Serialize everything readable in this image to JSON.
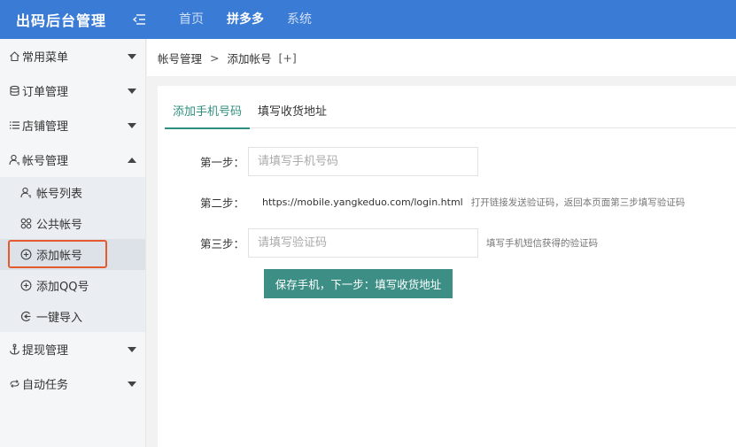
{
  "header": {
    "brand": "出码后台管理",
    "nav": [
      "首页",
      "拼多多",
      "系统"
    ],
    "active_nav": "拼多多"
  },
  "sidebar": {
    "groups": [
      {
        "label": "常用菜单",
        "icon": "home-icon"
      },
      {
        "label": "订单管理",
        "icon": "database-icon"
      },
      {
        "label": "店铺管理",
        "icon": "list-icon"
      },
      {
        "label": "帐号管理",
        "icon": "user-icon",
        "expanded": true
      },
      {
        "label": "提现管理",
        "icon": "anchor-icon"
      },
      {
        "label": "自动任务",
        "icon": "sync-icon"
      }
    ],
    "account_submenu": [
      {
        "label": "帐号列表",
        "icon": "user-icon"
      },
      {
        "label": "公共帐号",
        "icon": "grid-circles-icon"
      },
      {
        "label": "添加帐号",
        "icon": "plus-circle-icon",
        "active": true
      },
      {
        "label": "添加QQ号",
        "icon": "plus-circle-icon"
      },
      {
        "label": "一键导入",
        "icon": "import-icon"
      }
    ]
  },
  "breadcrumb": {
    "parent": "帐号管理",
    "separator": ">",
    "current": "添加帐号",
    "refresh": "[+]"
  },
  "tabs": [
    {
      "label": "添加手机号码",
      "active": true
    },
    {
      "label": "填写收货地址",
      "active": false
    }
  ],
  "form": {
    "step1": {
      "label": "第一步：",
      "placeholder": "请填写手机号码"
    },
    "step2": {
      "label": "第二步：",
      "link": "https://mobile.yangkeduo.com/login.html",
      "hint": "打开链接发送验证码，返回本页面第三步填写验证码"
    },
    "step3": {
      "label": "第三步：",
      "placeholder": "请填写验证码",
      "hint": "填写手机短信获得的验证码"
    },
    "submit_label": "保存手机，下一步：填写收货地址"
  },
  "colors": {
    "header_bg": "#3a7bd5",
    "accent": "#2f8f7f",
    "button": "#3d8f86",
    "highlight": "#e45a2f"
  }
}
